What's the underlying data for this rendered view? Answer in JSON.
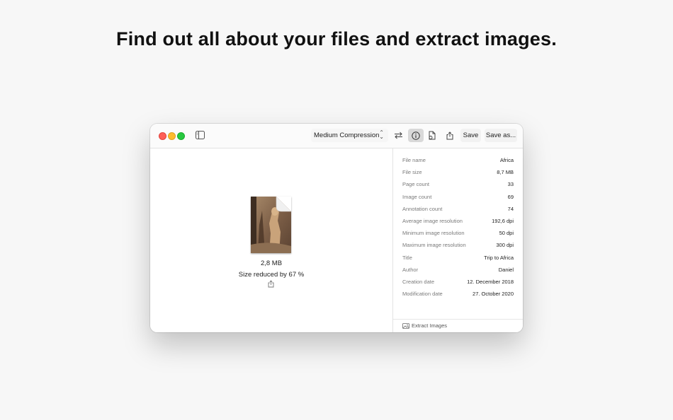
{
  "headline": "Find out all about your files and extract images.",
  "toolbar": {
    "compression_label": "Medium Compression",
    "save_label": "Save",
    "save_as_label": "Save as..."
  },
  "document": {
    "size": "2,8 MB",
    "reduced": "Size reduced by 67 %"
  },
  "info": [
    {
      "key": "File name",
      "value": "Africa"
    },
    {
      "key": "File size",
      "value": "8,7 MB"
    },
    {
      "key": "Page count",
      "value": "33"
    },
    {
      "key": "Image count",
      "value": "69"
    },
    {
      "key": "Annotation count",
      "value": "74"
    },
    {
      "key": "Average image resolution",
      "value": "192,6 dpi"
    },
    {
      "key": "Minimum image resolution",
      "value": "50 dpi"
    },
    {
      "key": "Maximum image resolution",
      "value": "300 dpi"
    },
    {
      "key": "Title",
      "value": "Trip to Africa"
    },
    {
      "key": "Author",
      "value": "Daniel"
    },
    {
      "key": "Creation date",
      "value": "12. December 2018"
    },
    {
      "key": "Modification date",
      "value": "27. October 2020"
    }
  ],
  "footer": {
    "extract_label": "Extract Images"
  },
  "icons": {
    "sidebar": "sidebar-icon",
    "swap": "swap-arrows-icon",
    "info": "info-icon",
    "extract": "extract-document-icon",
    "share": "share-icon",
    "photo": "photo-icon"
  },
  "colors": {
    "close": "#fe5f57",
    "minimize": "#febc2e",
    "zoom": "#28c840"
  }
}
